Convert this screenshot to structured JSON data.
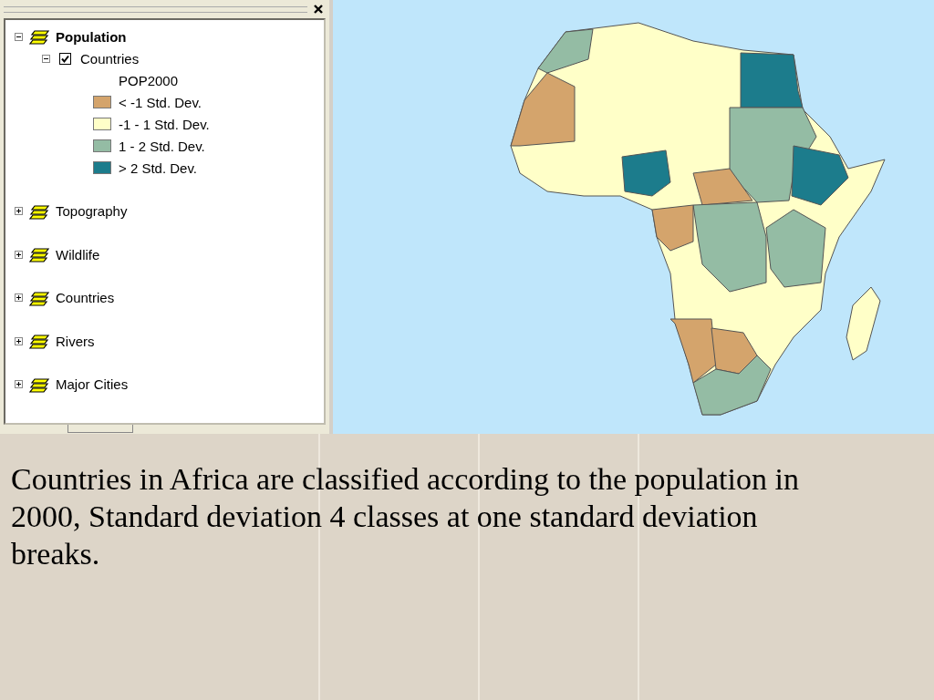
{
  "toc": {
    "groups": [
      {
        "name": "Population",
        "active": true,
        "expanded": true,
        "layers": [
          {
            "name": "Countries",
            "checked": true,
            "expanded": true,
            "field": "POP2000",
            "classes": [
              {
                "label": "< -1 Std. Dev.",
                "color": "#d4a46c"
              },
              {
                "label": "-1 - 1 Std. Dev.",
                "color": "#ffffc8"
              },
              {
                "label": "1 - 2 Std. Dev.",
                "color": "#94bca4"
              },
              {
                "label": "> 2 Std. Dev.",
                "color": "#1c7c8c"
              }
            ]
          }
        ]
      },
      {
        "name": "Topography",
        "active": false,
        "expanded": false
      },
      {
        "name": "Wildlife",
        "active": false,
        "expanded": false
      },
      {
        "name": "Countries",
        "active": false,
        "expanded": false
      },
      {
        "name": "Rivers",
        "active": false,
        "expanded": false
      },
      {
        "name": "Major Cities",
        "active": false,
        "expanded": false
      }
    ]
  },
  "caption": "Countries in Africa are classified according to the population in 2000, Standard deviation 4 classes at one standard deviation breaks."
}
